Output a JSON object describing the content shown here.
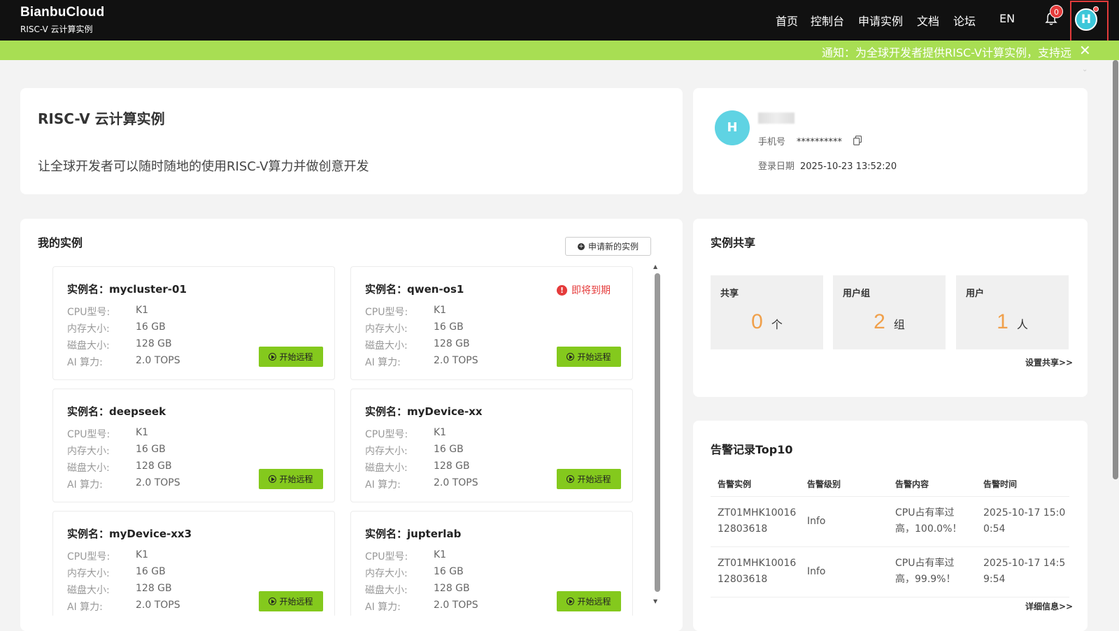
{
  "header": {
    "brand": "BianbuCloud",
    "subtitle": "RISC-V 云计算实例",
    "nav": [
      "首页",
      "控制台",
      "申请实例",
      "文档",
      "论坛",
      "EN"
    ],
    "bell_count": "0",
    "avatar_letter": "H"
  },
  "notice": {
    "text": "通知：为全球开发者提供RISC-V计算实例，支持远",
    "close": "✕"
  },
  "intro": {
    "title": "RISC-V 云计算实例",
    "desc": "让全球开发者可以随时随地的使用RISC-V算力并做创意开发"
  },
  "profile": {
    "avatar_letter": "H",
    "phone_label": "手机号",
    "phone_value": "**********",
    "login_label": "登录日期",
    "login_value": "2025-10-23 13:52:20"
  },
  "instances": {
    "title": "我的实例",
    "apply_label": "申请新的实例",
    "start_label": "开始远程",
    "expire_label": "即将到期",
    "row_labels": {
      "cpu": "CPU型号:",
      "mem": "内存大小:",
      "disk": "磁盘大小:",
      "ai": "AI 算力:"
    },
    "items": [
      {
        "name": "实例名：mycluster-01",
        "cpu": "K1",
        "mem": "16 GB",
        "disk": "128 GB",
        "ai": "2.0 TOPS"
      },
      {
        "name": "实例名：qwen-os1",
        "cpu": "K1",
        "mem": "16 GB",
        "disk": "128 GB",
        "ai": "2.0 TOPS"
      },
      {
        "name": "实例名：deepseek",
        "cpu": "K1",
        "mem": "16 GB",
        "disk": "128 GB",
        "ai": "2.0 TOPS"
      },
      {
        "name": "实例名：myDevice-xx",
        "cpu": "K1",
        "mem": "16 GB",
        "disk": "128 GB",
        "ai": "2.0 TOPS"
      },
      {
        "name": "实例名：myDevice-xx3",
        "cpu": "K1",
        "mem": "16 GB",
        "disk": "128 GB",
        "ai": "2.0 TOPS"
      },
      {
        "name": "实例名：jupterlab",
        "cpu": "K1",
        "mem": "16 GB",
        "disk": "128 GB",
        "ai": "2.0 TOPS"
      }
    ]
  },
  "share": {
    "title": "实例共享",
    "boxes": [
      {
        "label": "共享",
        "num": "0",
        "unit": "个"
      },
      {
        "label": "用户组",
        "num": "2",
        "unit": "组"
      },
      {
        "label": "用户",
        "num": "1",
        "unit": "人"
      }
    ],
    "link": "设置共享>>"
  },
  "alerts": {
    "title": "告警记录Top10",
    "headers": [
      "告警实例",
      "告警级别",
      "告警内容",
      "告警时间"
    ],
    "rows": [
      [
        "ZT01MHK1001612803618",
        "Info",
        "CPU占有率过高，100.0%！",
        "2025-10-17 15:00:54"
      ],
      [
        "ZT01MHK1001612803618",
        "Info",
        "CPU占有率过高，99.9%！",
        "2025-10-17 14:59:54"
      ]
    ],
    "link": "详细信息>>"
  },
  "colors": {
    "accent_green": "#84c91d",
    "notice_bg": "#a8de53",
    "warn_red": "#e53b3b",
    "share_orange": "#f0a04b",
    "avatar_teal": "#3dc7d9"
  }
}
